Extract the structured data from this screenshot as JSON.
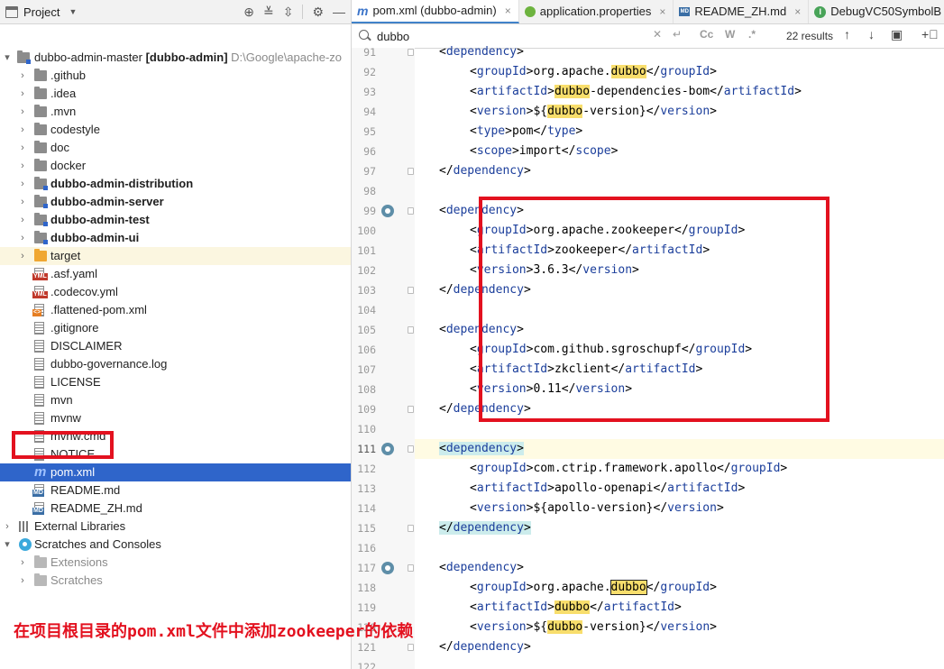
{
  "project_panel": {
    "title": "Project",
    "root": {
      "name": "dubbo-admin-master",
      "module": "[dubbo-admin]",
      "path": "D:\\Google\\apache-zo"
    },
    "items": [
      {
        "label": "github",
        "prefix": ".",
        "kind": "folder"
      },
      {
        "label": "idea",
        "prefix": ".",
        "kind": "folder"
      },
      {
        "label": "mvn",
        "prefix": ".",
        "kind": "folder"
      },
      {
        "label": "codestyle",
        "kind": "folder"
      },
      {
        "label": "doc",
        "kind": "folder"
      },
      {
        "label": "docker",
        "kind": "folder"
      },
      {
        "label": "dubbo-admin-distribution",
        "kind": "module"
      },
      {
        "label": "dubbo-admin-server",
        "kind": "module"
      },
      {
        "label": "dubbo-admin-test",
        "kind": "module"
      },
      {
        "label": "dubbo-admin-ui",
        "kind": "module"
      },
      {
        "label": "target",
        "kind": "excluded-folder"
      },
      {
        "label": ".asf.yaml",
        "kind": "yml-file"
      },
      {
        "label": ".codecov.yml",
        "kind": "yml-file"
      },
      {
        "label": ".flattened-pom.xml",
        "kind": "xml-file"
      },
      {
        "label": ".gitignore",
        "kind": "ignore-file"
      },
      {
        "label": "DISCLAIMER",
        "kind": "text-file"
      },
      {
        "label": "dubbo-governance.log",
        "kind": "text-file"
      },
      {
        "label": "LICENSE",
        "kind": "text-file"
      },
      {
        "label": "mvn",
        "kind": "unknown-file"
      },
      {
        "label": "mvnw",
        "kind": "script-file"
      },
      {
        "label": "mvnw.cmd",
        "kind": "text-file"
      },
      {
        "label": "NOTICE",
        "kind": "text-file"
      },
      {
        "label": "pom.xml",
        "kind": "maven-file",
        "selected": true
      },
      {
        "label": "README.md",
        "kind": "md-file"
      },
      {
        "label": "README_ZH.md",
        "kind": "md-file"
      }
    ],
    "external_libraries": "External Libraries",
    "scratches_and_consoles": "Scratches and Consoles",
    "extensions": "Extensions",
    "scratches": "Scratches"
  },
  "editor": {
    "tabs": [
      {
        "label": "pom.xml (dubbo-admin)",
        "icon": "maven-icon",
        "active": true
      },
      {
        "label": "application.properties",
        "icon": "spring-leaf-icon"
      },
      {
        "label": "README_ZH.md",
        "icon": "markdown-icon"
      },
      {
        "label": "DebugVC50SymbolB",
        "icon": "interface-icon"
      }
    ],
    "search": {
      "query": "dubbo",
      "results": "22 results",
      "case_label": "Cc",
      "words_label": "W",
      "regex_label": ".*"
    },
    "lines": [
      {
        "n": "91",
        "indent": 0,
        "t": "<dependency>",
        "partial": true
      },
      {
        "n": "92",
        "indent": 1,
        "t": "<groupId>org.apache.dubbo</groupId>"
      },
      {
        "n": "93",
        "indent": 1,
        "t": "<artifactId>dubbo-dependencies-bom</artifactId>"
      },
      {
        "n": "94",
        "indent": 1,
        "t": "<version>${dubbo-version}</version>"
      },
      {
        "n": "95",
        "indent": 1,
        "t": "<type>pom</type>"
      },
      {
        "n": "96",
        "indent": 1,
        "t": "<scope>import</scope>"
      },
      {
        "n": "97",
        "indent": 0,
        "t": "</dependency>"
      },
      {
        "n": "98",
        "indent": 0,
        "t": ""
      },
      {
        "n": "99",
        "indent": 0,
        "t": "<dependency>"
      },
      {
        "n": "100",
        "indent": 1,
        "t": "<groupId>org.apache.zookeeper</groupId>"
      },
      {
        "n": "101",
        "indent": 1,
        "t": "<artifactId>zookeeper</artifactId>"
      },
      {
        "n": "102",
        "indent": 1,
        "t": "<version>3.6.3</version>"
      },
      {
        "n": "103",
        "indent": 0,
        "t": "</dependency>"
      },
      {
        "n": "104",
        "indent": 0,
        "t": ""
      },
      {
        "n": "105",
        "indent": 0,
        "t": "<dependency>"
      },
      {
        "n": "106",
        "indent": 1,
        "t": "<groupId>com.github.sgroschupf</groupId>"
      },
      {
        "n": "107",
        "indent": 1,
        "t": "<artifactId>zkclient</artifactId>"
      },
      {
        "n": "108",
        "indent": 1,
        "t": "<version>0.11</version>"
      },
      {
        "n": "109",
        "indent": 0,
        "t": "</dependency>"
      },
      {
        "n": "110",
        "indent": 0,
        "t": ""
      },
      {
        "n": "111",
        "indent": 0,
        "t": "<dependency>",
        "current": true
      },
      {
        "n": "112",
        "indent": 1,
        "t": "<groupId>com.ctrip.framework.apollo</groupId>"
      },
      {
        "n": "113",
        "indent": 1,
        "t": "<artifactId>apollo-openapi</artifactId>"
      },
      {
        "n": "114",
        "indent": 1,
        "t": "<version>${apollo-version}</version>"
      },
      {
        "n": "115",
        "indent": 0,
        "t": "</dependency>",
        "tag_bg": true
      },
      {
        "n": "116",
        "indent": 0,
        "t": ""
      },
      {
        "n": "117",
        "indent": 0,
        "t": "<dependency>"
      },
      {
        "n": "118",
        "indent": 1,
        "t": "<groupId>org.apache.dubbo</groupId>",
        "current_match": true
      },
      {
        "n": "119",
        "indent": 1,
        "t": "<artifactId>dubbo</artifactId>"
      },
      {
        "n": "120",
        "indent": 1,
        "t": "<version>${dubbo-version}</version>"
      },
      {
        "n": "121",
        "indent": 0,
        "t": "</dependency>"
      },
      {
        "n": "122",
        "indent": 0,
        "t": ""
      }
    ]
  },
  "annotation": "在项目根目录的pom.xml文件中添加zookeeper的依赖",
  "colors": {
    "annotation_red": "#e3111f",
    "selection_blue": "#2f65ca",
    "tag_blue": "#1b3e9b",
    "match_yellow": "#f8de6c"
  }
}
